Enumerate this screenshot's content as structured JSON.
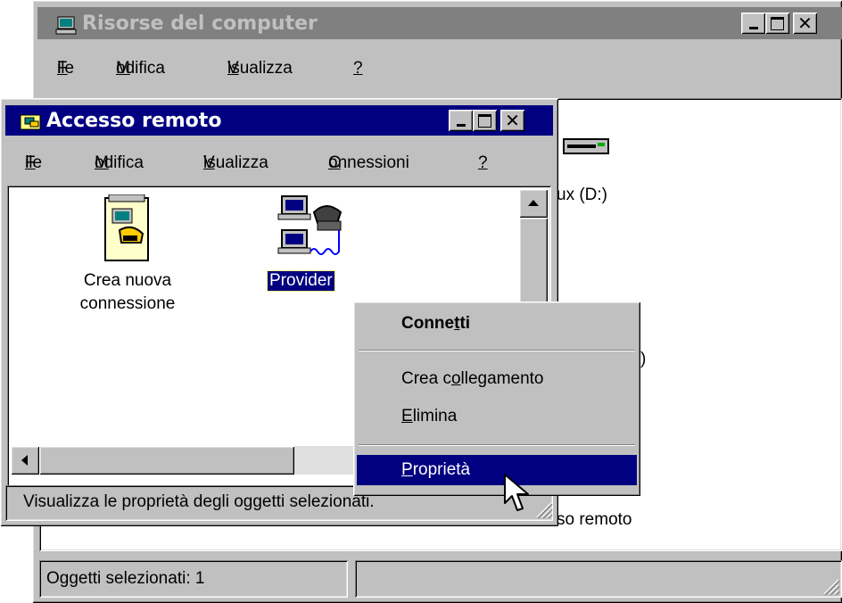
{
  "back_window": {
    "title": "Risorse del computer",
    "menu": {
      "file": "File",
      "modifica": "Modifica",
      "visualizza": "Visualizza",
      "help": "?"
    },
    "items": {
      "drive_d_partial": "ux (D:)",
      "remote_partial": "so remoto",
      "drive3_partial": ")"
    },
    "status": "Oggetti selezionati: 1"
  },
  "front_window": {
    "title": "Accesso remoto",
    "menu": {
      "file": "File",
      "modifica": "Modifica",
      "visualizza": "Visualizza",
      "connessioni": "Connessioni",
      "help": "?"
    },
    "icons": {
      "new_connection_line1": "Crea nuova",
      "new_connection_line2": "connessione",
      "provider": "Provider"
    },
    "status": "Visualizza le proprietà degli oggetti selezionati."
  },
  "context_menu": {
    "connect": "Connetti",
    "create_shortcut": "Crea collegamento",
    "delete": "Elimina",
    "properties": "Proprietà"
  },
  "colors": {
    "titlebar_active": "#000080",
    "titlebar_inactive": "#808080",
    "face": "#c0c0c0",
    "selection": "#000080"
  }
}
